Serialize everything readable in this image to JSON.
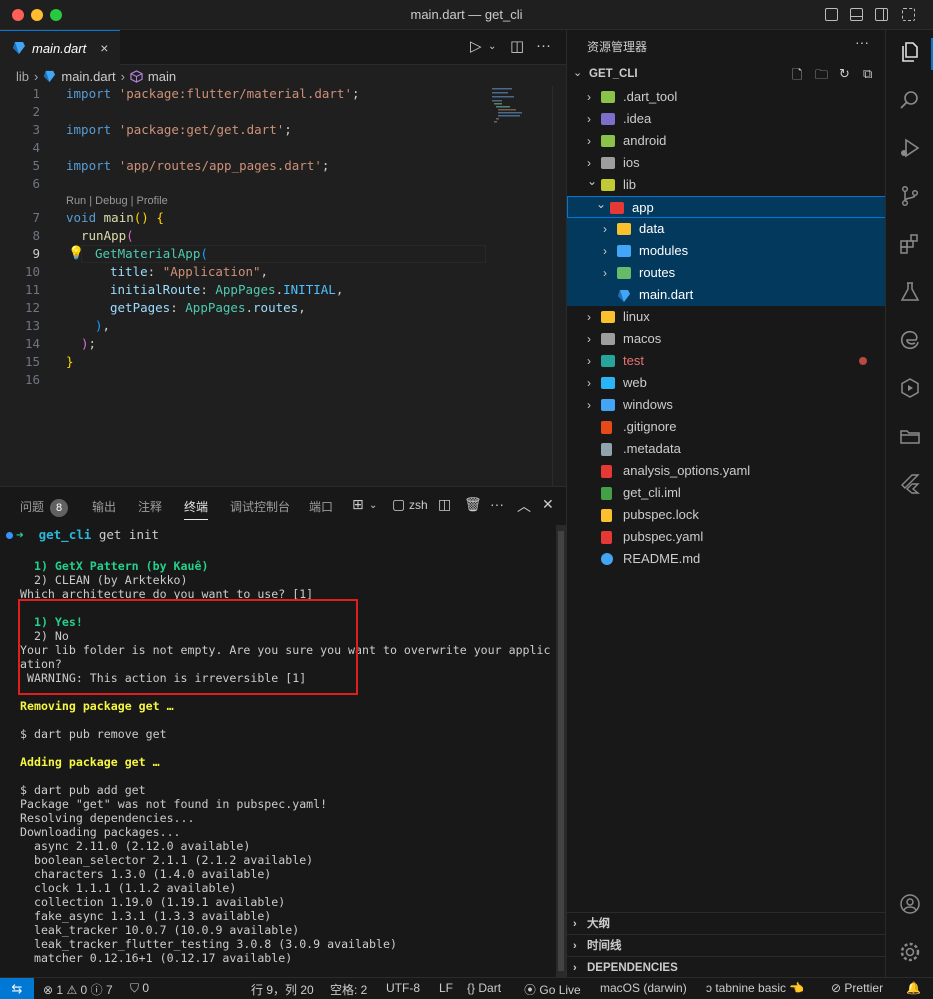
{
  "window": {
    "title": "main.dart — get_cli"
  },
  "editor": {
    "tab": {
      "label": "main.dart",
      "close_icon": "×"
    },
    "breadcrumb": {
      "folder": "lib",
      "file": "main.dart",
      "symbol": "main",
      "sep": "›"
    },
    "codelens": "Run | Debug | Profile",
    "lines": [
      {
        "n": "1",
        "t1": "import",
        "t2": "'package:flutter/material.dart'",
        "t3": ";"
      },
      {
        "n": "2"
      },
      {
        "n": "3",
        "t1": "import",
        "t2": "'package:get/get.dart'",
        "t3": ";"
      },
      {
        "n": "4"
      },
      {
        "n": "5",
        "t1": "import",
        "t2": "'app/routes/app_pages.dart'",
        "t3": ";"
      },
      {
        "n": "6"
      },
      {
        "n": "7",
        "t1": "void",
        "t2": "main",
        "t3": "()",
        "t4": " {"
      },
      {
        "n": "8",
        "t1": "runApp",
        "t2": "("
      },
      {
        "n": "9",
        "t1": "GetMaterialApp",
        "t2": "("
      },
      {
        "n": "10",
        "t1": "title",
        "t2": ": ",
        "t3": "\"Application\"",
        "t4": ","
      },
      {
        "n": "11",
        "t1": "initialRoute",
        "t2": ": ",
        "t3": "AppPages",
        "t4": ".",
        "t5": "INITIAL",
        "t6": ","
      },
      {
        "n": "12",
        "t1": "getPages",
        "t2": ": ",
        "t3": "AppPages",
        "t4": ".",
        "t5": "routes",
        "t6": ","
      },
      {
        "n": "13",
        "t1": ")",
        "t2": ","
      },
      {
        "n": "14",
        "t1": ")",
        "t2": ";"
      },
      {
        "n": "15",
        "t1": "}"
      },
      {
        "n": "16"
      }
    ]
  },
  "panel": {
    "tabs": [
      "问题",
      "输出",
      "注释",
      "终端",
      "调试控制台",
      "端口"
    ],
    "problem_count": "8",
    "shell": "zsh",
    "terminal": {
      "prompt_arrow": "➜",
      "prompt_dir": "get_cli",
      "prompt_cmd": "get init",
      "lines": [
        "",
        "  1) GetX Pattern (by Kauê)",
        "  2) CLEAN (by Arktekko)",
        "Which architecture do you want to use? [1]",
        "",
        "  1) Yes!",
        "  2) No",
        "Your lib folder is not empty. Are you sure you want to overwrite your applic",
        "ation?",
        " WARNING: This action is irreversible [1]",
        "",
        "Removing package get …",
        "",
        "$ dart pub remove get",
        "",
        "Adding package get …",
        "",
        "$ dart pub add get",
        "Package \"get\" was not found in pubspec.yaml!",
        "Resolving dependencies...",
        "Downloading packages...",
        "  async 2.11.0 (2.12.0 available)",
        "  boolean_selector 2.1.1 (2.1.2 available)",
        "  characters 1.3.0 (1.4.0 available)",
        "  clock 1.1.1 (1.1.2 available)",
        "  collection 1.19.0 (1.19.1 available)",
        "  fake_async 1.3.1 (1.3.3 available)",
        "  leak_tracker 10.0.7 (10.0.9 available)",
        "  leak_tracker_flutter_testing 3.0.8 (3.0.9 available)",
        "  matcher 0.12.16+1 (0.12.17 available)"
      ]
    }
  },
  "sidebar": {
    "title": "资源管理器",
    "more_icon": "···",
    "project": "GET_CLI",
    "tree": [
      {
        "name": ".dart_tool",
        "depth": 0,
        "kind": "folder",
        "open": false,
        "color": "#8bc34a"
      },
      {
        "name": ".idea",
        "depth": 0,
        "kind": "folder",
        "open": false,
        "color": "#7b6fc9"
      },
      {
        "name": "android",
        "depth": 0,
        "kind": "folder",
        "open": false,
        "color": "#8bc34a"
      },
      {
        "name": "ios",
        "depth": 0,
        "kind": "folder",
        "open": false,
        "color": "#9e9e9e"
      },
      {
        "name": "lib",
        "depth": 0,
        "kind": "folder",
        "open": true,
        "color": "#c0ca33"
      },
      {
        "name": "app",
        "depth": 1,
        "kind": "folder",
        "open": true,
        "color": "#e53935"
      },
      {
        "name": "data",
        "depth": 2,
        "kind": "folder",
        "open": false,
        "color": "#fbc02d"
      },
      {
        "name": "modules",
        "depth": 2,
        "kind": "folder",
        "open": false,
        "color": "#42a5f5"
      },
      {
        "name": "routes",
        "depth": 2,
        "kind": "folder",
        "open": false,
        "color": "#66bb6a"
      },
      {
        "name": "main.dart",
        "depth": 2,
        "kind": "dart",
        "color": "#42a5f5"
      },
      {
        "name": "linux",
        "depth": 0,
        "kind": "folder",
        "open": false,
        "color": "#fbc02d"
      },
      {
        "name": "macos",
        "depth": 0,
        "kind": "folder",
        "open": false,
        "color": "#9e9e9e"
      },
      {
        "name": "test",
        "depth": 0,
        "kind": "folder",
        "open": false,
        "color": "#26a69a",
        "modified": true,
        "name_color": "#e57373"
      },
      {
        "name": "web",
        "depth": 0,
        "kind": "folder",
        "open": false,
        "color": "#29b6f6"
      },
      {
        "name": "windows",
        "depth": 0,
        "kind": "folder",
        "open": false,
        "color": "#42a5f5"
      },
      {
        "name": ".gitignore",
        "depth": 0,
        "kind": "file",
        "color": "#e64a19"
      },
      {
        "name": ".metadata",
        "depth": 0,
        "kind": "file",
        "color": "#90a4ae"
      },
      {
        "name": "analysis_options.yaml",
        "depth": 0,
        "kind": "file",
        "color": "#e53935"
      },
      {
        "name": "get_cli.iml",
        "depth": 0,
        "kind": "file",
        "color": "#43a047"
      },
      {
        "name": "pubspec.lock",
        "depth": 0,
        "kind": "file",
        "color": "#fbc02d"
      },
      {
        "name": "pubspec.yaml",
        "depth": 0,
        "kind": "file",
        "color": "#e53935"
      },
      {
        "name": "README.md",
        "depth": 0,
        "kind": "info",
        "color": "#42a5f5"
      }
    ],
    "sections": [
      "大纲",
      "时间线",
      "DEPENDENCIES"
    ]
  },
  "statusbar": {
    "remote_icon": "⇆",
    "errors": "1",
    "warnings": "0",
    "infos": "7",
    "ports": "0",
    "position": "行 9，列 20",
    "indent": "空格: 2",
    "encoding": "UTF-8",
    "eol": "LF",
    "language": "Dart",
    "golive": "Go Live",
    "device": "macOS (darwin)",
    "tabnine": "tabnine basic",
    "prettier": "Prettier",
    "bell_icon": "bell-icon"
  },
  "colors": {
    "accent": "#0078d4",
    "highlight_box": "#e11d1d",
    "selection": "#04395e"
  }
}
